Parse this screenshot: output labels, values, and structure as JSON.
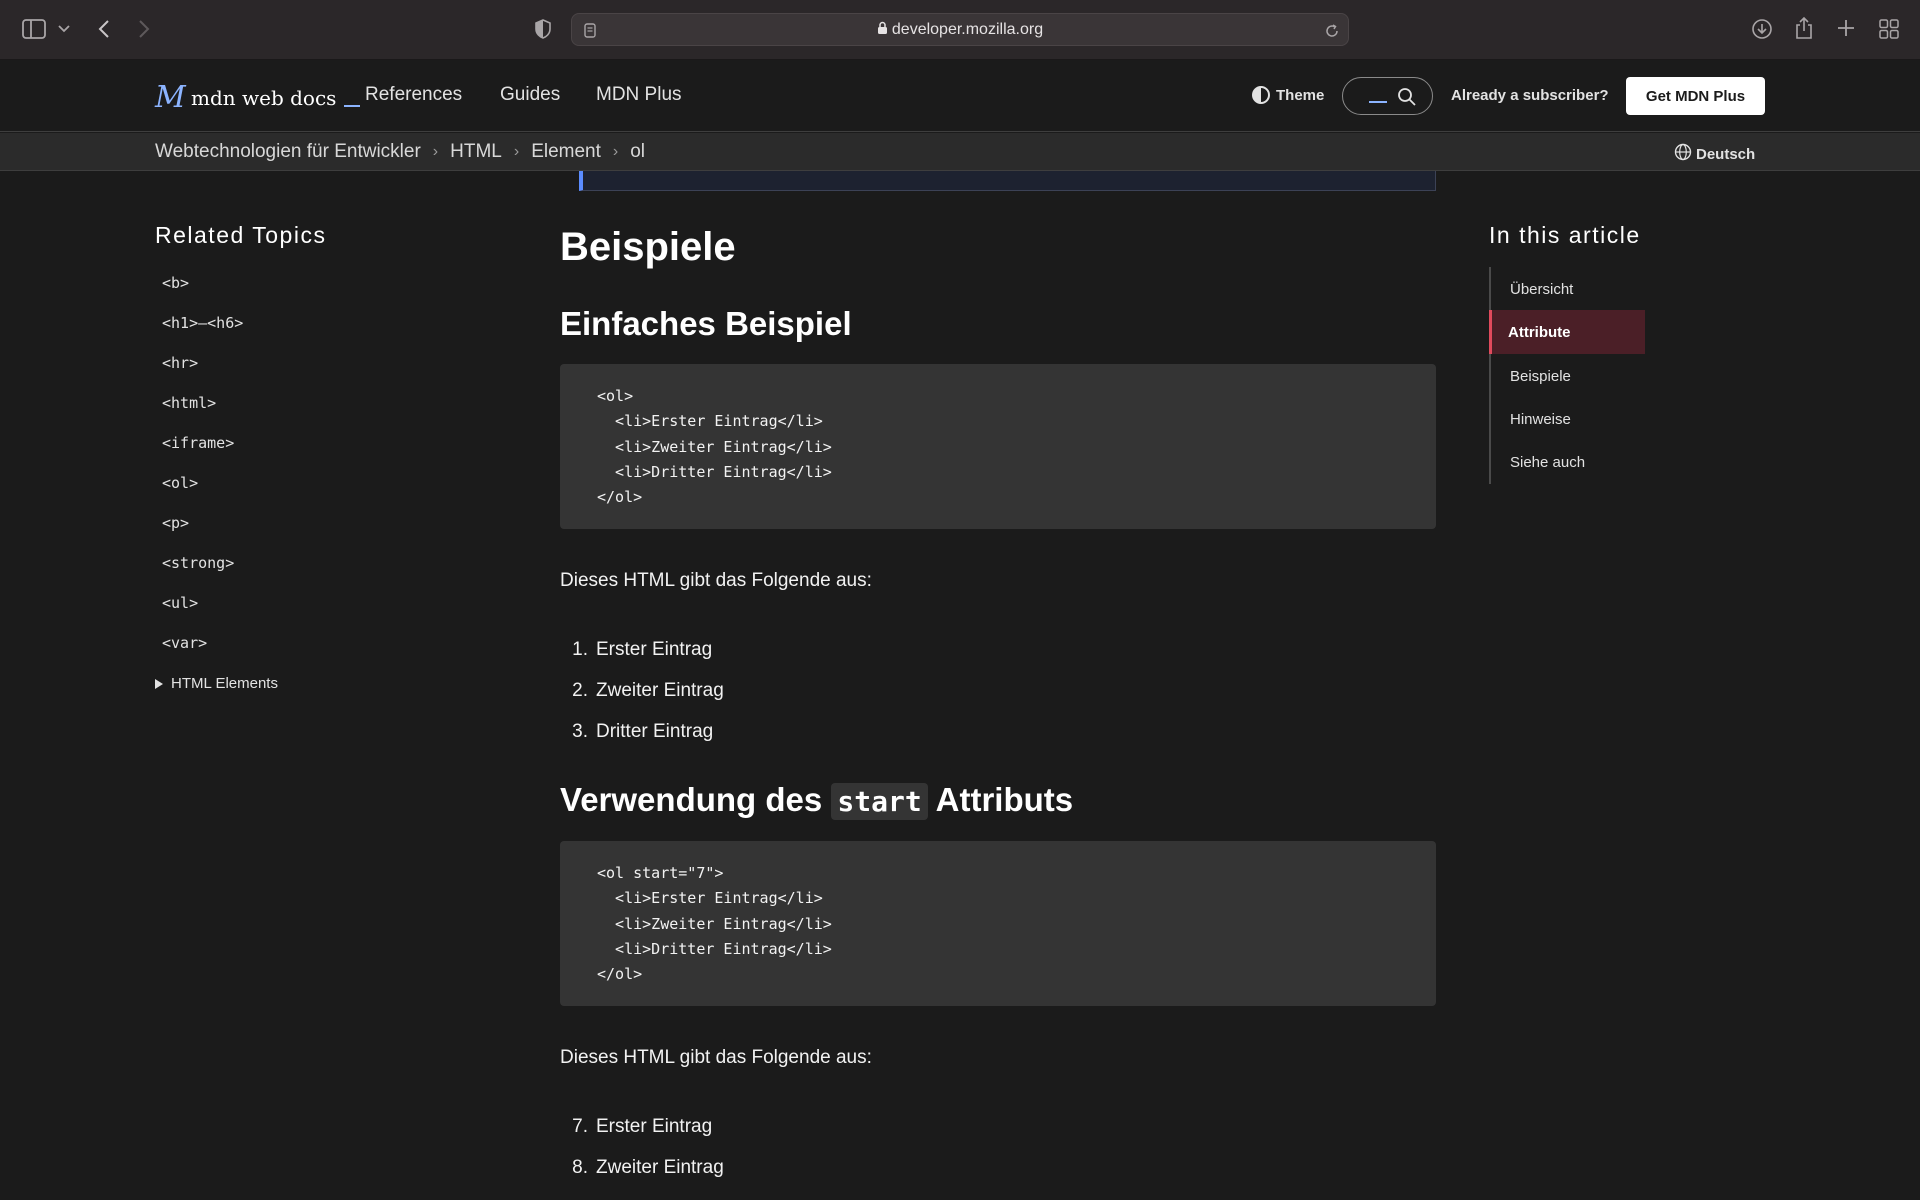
{
  "browser": {
    "url_host": "developer.mozilla.org",
    "icons": [
      "sidebar-toggle-icon",
      "chevron-down-icon",
      "back-icon",
      "forward-icon",
      "privacy-shield-icon",
      "reader-icon",
      "lock-icon",
      "reload-icon",
      "download-icon",
      "share-icon",
      "new-tab-icon",
      "tab-overview-icon"
    ]
  },
  "header": {
    "logo_text": "mdn web docs",
    "nav": [
      "References",
      "Guides",
      "MDN Plus"
    ],
    "theme_label": "Theme",
    "subscriber_label": "Already a subscriber?",
    "get_plus_label": "Get MDN Plus"
  },
  "breadcrumb": {
    "items": [
      "Webtechnologien für Entwickler",
      "HTML",
      "Element",
      "ol"
    ],
    "language": "Deutsch"
  },
  "sidebar": {
    "title": "Related Topics",
    "items": [
      "<b>",
      "<h1>–<h6>",
      "<hr>",
      "<html>",
      "<iframe>",
      "<ol>",
      "<p>",
      "<strong>",
      "<ul>",
      "<var>"
    ],
    "details_label": "HTML Elements"
  },
  "main": {
    "heading": "Beispiele",
    "sections": [
      {
        "title": "Einfaches Beispiel",
        "code": "<ol>\n  <li>Erster Eintrag</li>\n  <li>Zweiter Eintrag</li>\n  <li>Dritter Eintrag</li>\n</ol>",
        "output_intro": "Dieses HTML gibt das Folgende aus:",
        "list": [
          {
            "num": "1.",
            "text": "Erster Eintrag"
          },
          {
            "num": "2.",
            "text": "Zweiter Eintrag"
          },
          {
            "num": "3.",
            "text": "Dritter Eintrag"
          }
        ]
      },
      {
        "title_before": "Verwendung des",
        "title_code": "start",
        "title_after": "Attributs",
        "code": "<ol start=\"7\">\n  <li>Erster Eintrag</li>\n  <li>Zweiter Eintrag</li>\n  <li>Dritter Eintrag</li>\n</ol>",
        "output_intro": "Dieses HTML gibt das Folgende aus:",
        "list": [
          {
            "num": "7.",
            "text": "Erster Eintrag"
          },
          {
            "num": "8.",
            "text": "Zweiter Eintrag"
          }
        ]
      }
    ]
  },
  "toc": {
    "title": "In this article",
    "items": [
      "Übersicht",
      "Attribute",
      "Beispiele",
      "Hinweise",
      "Siehe auch"
    ],
    "active": "Attribute"
  },
  "colors": {
    "background": "#1b1b1b",
    "accent": "#8cb4ff",
    "toc_active_bg": "#4b1f27",
    "toc_active_border": "#e04a5c"
  }
}
